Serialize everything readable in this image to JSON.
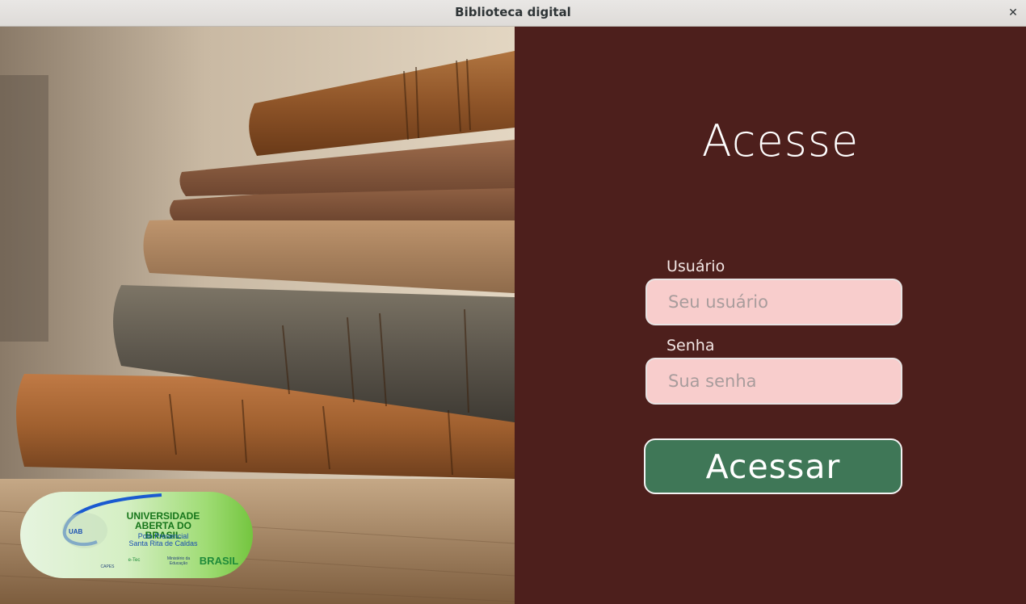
{
  "window": {
    "title": "Biblioteca digital",
    "close_glyph": "✕"
  },
  "logo": {
    "title_line1": "UNIVERSIDADE",
    "title_line2": "ABERTA DO BRASIL",
    "subtitle_line1": "Polo Presencial",
    "subtitle_line2": "Santa Rita de Caldas",
    "tag": "UAB",
    "partners": [
      "CAPES",
      "e-Tec",
      "Ministério da Educação",
      "BRASIL"
    ]
  },
  "login": {
    "heading": "Acesse",
    "user_label": "Usuário",
    "user_placeholder": "Seu usuário",
    "password_label": "Senha",
    "password_placeholder": "Sua senha",
    "submit_label": "Acessar"
  },
  "colors": {
    "panel_bg": "#4d1f1c",
    "field_bg": "#f8cdcc",
    "button_bg": "#3f7757"
  }
}
